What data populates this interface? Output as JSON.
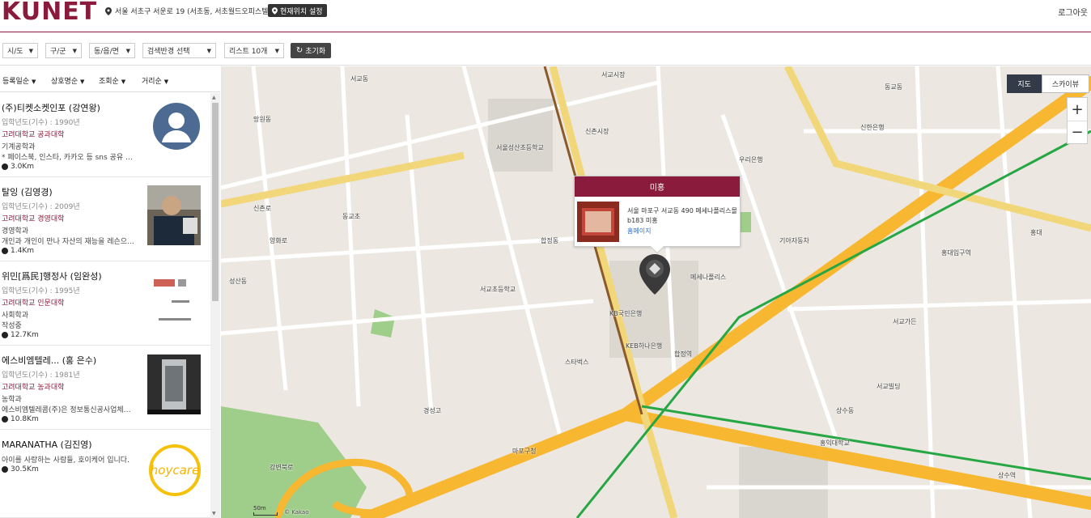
{
  "header": {
    "logo": "KUNET",
    "address": "서울 서초구 서운로 19 (서초동, 서초월드오피스텔)",
    "set_location_button": "현재위치 설정",
    "logout": "로그아웃"
  },
  "filters": {
    "sido": "시/도",
    "gugun": "구/군",
    "dong": "동/읍/면",
    "radius": "검색반경 선택",
    "list_size": "리스트 10개",
    "reset": "초기화"
  },
  "sort": {
    "registered": "등록일순",
    "company": "상호명순",
    "views": "조회순",
    "distance": "거리순"
  },
  "listings": [
    {
      "name": "(주)티켓소켓인포 (강연왕)",
      "year": "입학년도(기수) : 1990년",
      "school": "고려대학교 공과대학",
      "dept": "기계공학과",
      "desc": "* 페이스북, 인스타, 카카오 등 sns 공유 …",
      "distance": "3.0Km"
    },
    {
      "name": "탈잉 (김영경)",
      "year": "입학년도(기수) : 2009년",
      "school": "고려대학교 경영대학",
      "dept": "경영학과",
      "desc": "개인과 개인이 만나 자산의 재능을 레슨으…",
      "distance": "1.4Km"
    },
    {
      "name": "위민[爲民]행정사 (임완성)",
      "year": "입학년도(기수) : 1995년",
      "school": "고려대학교 인문대학",
      "dept": "사회학과",
      "desc": "작성중",
      "distance": "12.7Km"
    },
    {
      "name": "에스비엠텔레... (홍 은수)",
      "year": "입학년도(기수) : 1981년",
      "school": "고려대학교 농과대학",
      "dept": "농학과",
      "desc": "에스비엠텔레콤(주)은 정보통신공사업체…",
      "distance": "10.8Km"
    },
    {
      "name": "MARANATHA (김진영)",
      "desc": "아이를 사랑하는 사람들, 호이케어 입니다.",
      "distance": "30.5Km",
      "logo_text": "hoycare"
    }
  ],
  "map": {
    "type_map": "지도",
    "type_skyview": "스카이뷰",
    "zoom_in": "+",
    "zoom_out": "−",
    "scale": "50m",
    "copyright": "© Kakao",
    "popup": {
      "title": "미홍",
      "address": "서울 마포구 서교동 490 메세나폴리스몰 b183 미홍",
      "link": "홈페이지"
    },
    "labels": [
      "서교동",
      "동교동",
      "신촌로",
      "양화로",
      "합정역",
      "홍대입구역",
      "서교초등학교",
      "신한은행",
      "우리은행",
      "KEB하나은행",
      "KB국민은행",
      "마포구청",
      "메세나폴리스",
      "망원동",
      "홍익대학교",
      "서교가든",
      "경성고",
      "서울성산초등학교",
      "스타벅스",
      "신촌시장",
      "상수동",
      "서교시장",
      "서교빌딩",
      "기아자동차",
      "동교초",
      "홍대",
      "상수역",
      "강변북로",
      "합정동",
      "성산동"
    ]
  },
  "colors": {
    "brand": "#8a1b3d",
    "map_bg": "#ece8e1",
    "road_major": "#f7b731",
    "subway_green": "#26a744"
  }
}
